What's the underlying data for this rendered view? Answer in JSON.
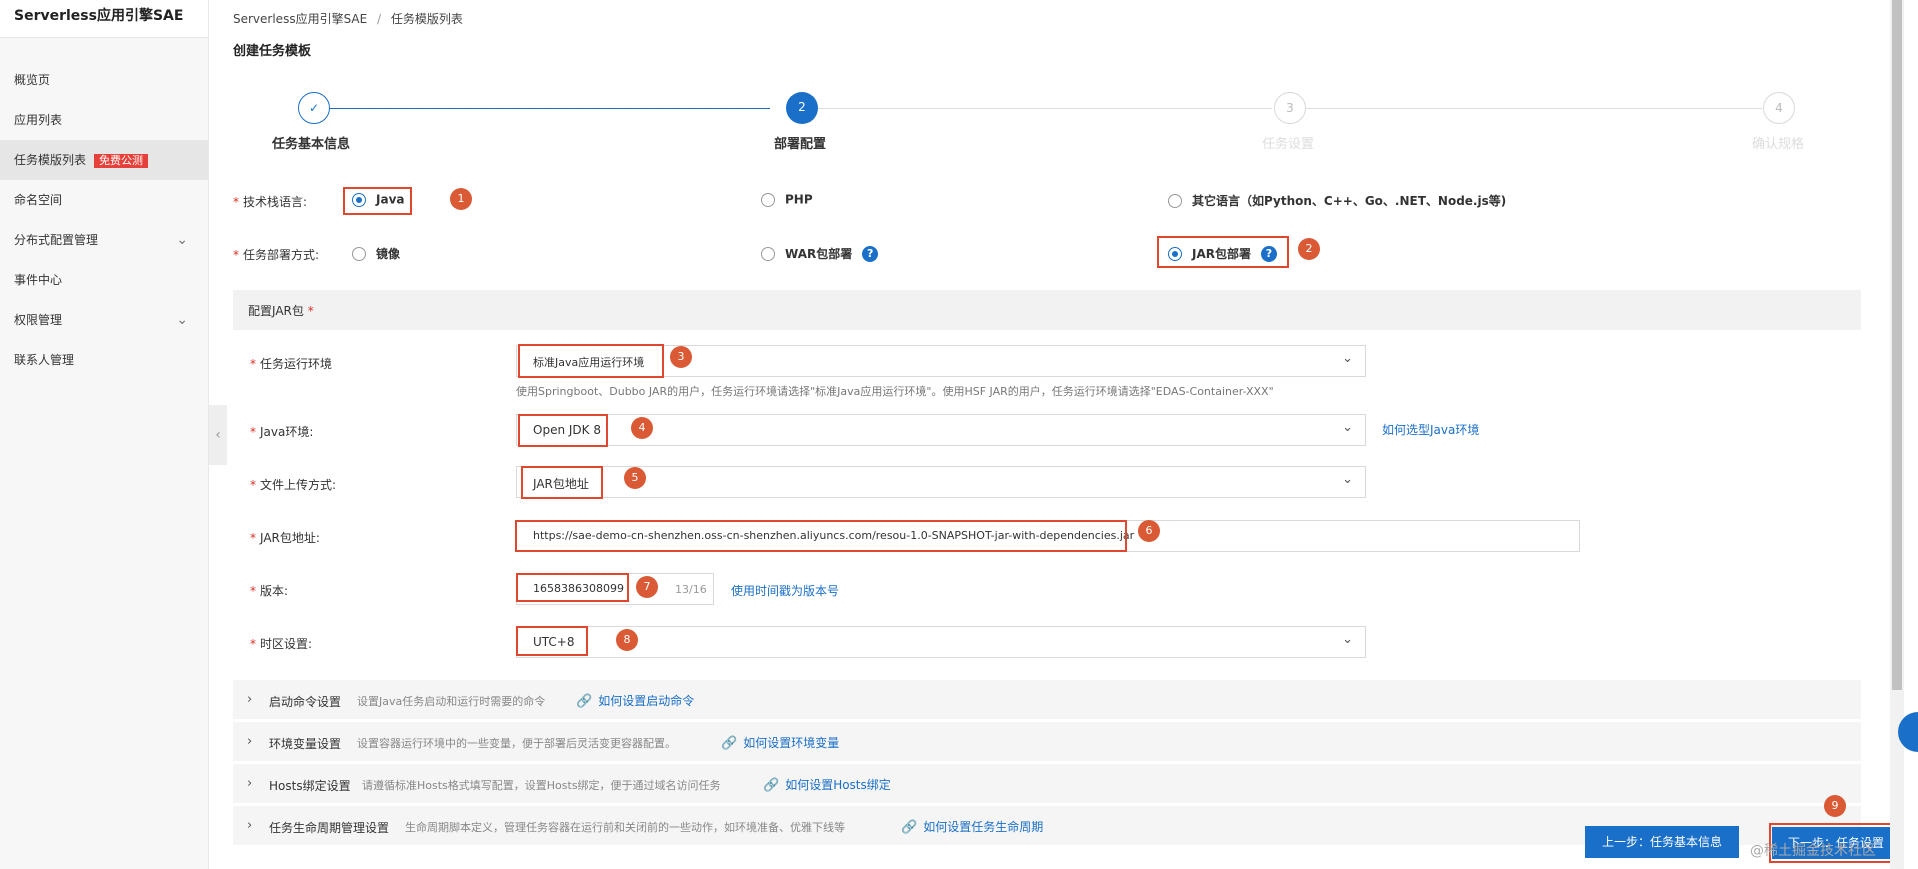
{
  "sidebar": {
    "title": "Serverless应用引擎SAE",
    "items": [
      {
        "label": "概览页"
      },
      {
        "label": "应用列表"
      },
      {
        "label": "任务模版列表",
        "badge": "免费公测"
      },
      {
        "label": "命名空间"
      },
      {
        "label": "分布式配置管理"
      },
      {
        "label": "事件中心"
      },
      {
        "label": "权限管理"
      },
      {
        "label": "联系人管理"
      }
    ]
  },
  "breadcrumb": {
    "root": "Serverless应用引擎SAE",
    "separator": "/",
    "current": "任务模版列表"
  },
  "page_title": "创建任务模板",
  "steps": [
    {
      "num": "✓",
      "label": "任务基本信息"
    },
    {
      "num": "2",
      "label": "部署配置"
    },
    {
      "num": "3",
      "label": "任务设置"
    },
    {
      "num": "4",
      "label": "确认规格"
    }
  ],
  "tech_stack": {
    "label": "技术栈语言:",
    "options": [
      "Java",
      "PHP",
      "其它语言（如Python、C++、Go、.NET、Node.js等)"
    ],
    "selected": "Java"
  },
  "deploy_mode": {
    "label": "任务部署方式:",
    "options": [
      "镜像",
      "WAR包部署",
      "JAR包部署"
    ],
    "selected": "JAR包部署"
  },
  "jar_panel": {
    "title": "配置JAR包",
    "required": "*"
  },
  "runtime_env": {
    "label": "任务运行环境",
    "value": "标准Java应用运行环境",
    "hint": "使用Springboot、Dubbo JAR的用户，任务运行环境请选择\"标准Java应用运行环境\"。使用HSF JAR的用户，任务运行环境请选择\"EDAS-Container-XXX\""
  },
  "java_env": {
    "label": "Java环境:",
    "value": "Open JDK 8",
    "link": "如何选型Java环境"
  },
  "upload_mode": {
    "label": "文件上传方式:",
    "value": "JAR包地址"
  },
  "jar_url": {
    "label": "JAR包地址:",
    "value": "https://sae-demo-cn-shenzhen.oss-cn-shenzhen.aliyuncs.com/resou-1.0-SNAPSHOT-jar-with-dependencies.jar"
  },
  "version": {
    "label": "版本:",
    "value": "1658386308099",
    "counter": "13/16",
    "link": "使用时间戳为版本号"
  },
  "timezone": {
    "label": "时区设置:",
    "value": "UTC+8"
  },
  "collapse_sections": [
    {
      "title": "启动命令设置",
      "desc": "设置Java任务启动和运行时需要的命令",
      "link": "如何设置启动命令"
    },
    {
      "title": "环境变量设置",
      "desc": "设置容器运行环境中的一些变量，便于部署后灵活变更容器配置。",
      "link": "如何设置环境变量"
    },
    {
      "title": "Hosts绑定设置",
      "desc": "请遵循标准Hosts格式填写配置，设置Hosts绑定，便于通过域名访问任务",
      "link": "如何设置Hosts绑定"
    },
    {
      "title": "任务生命周期管理设置",
      "desc": "生命周期脚本定义，管理任务容器在运行前和关闭前的一些动作，如环境准备、优雅下线等",
      "link": "如何设置任务生命周期"
    }
  ],
  "buttons": {
    "prev": "上一步：任务基本信息",
    "next": "下一步：任务设置"
  },
  "annotations": [
    "1",
    "2",
    "3",
    "4",
    "5",
    "6",
    "7",
    "8",
    "9"
  ],
  "required_mark": "*",
  "watermark": "@稀土掘金技术社区",
  "colors": {
    "accent": "#1a6fc8",
    "highlight": "#e0472f",
    "badge": "#d95a35"
  }
}
